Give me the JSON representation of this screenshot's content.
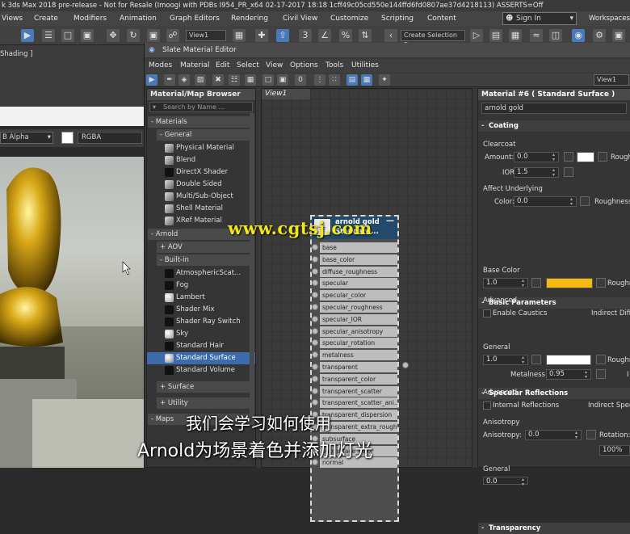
{
  "app": {
    "title": "k 3ds Max 2018 pre-release - Not for Resale (Imoogi with PDBs I954_PR_x64 02-17-2017 18:18 1cff49c05cd550e144ffd6fd0807ae37d4218113) ASSERTS=Off",
    "menu": [
      "Views",
      "Create",
      "Modifiers",
      "Animation",
      "Graph Editors",
      "Rendering",
      "Civil View",
      "Customize",
      "Scripting",
      "Content"
    ],
    "signin": "Sign In",
    "workspaces": "Workspaces:",
    "view_dropdown": "View",
    "selection_set": "Create Selection Se"
  },
  "viewport": {
    "shading_label": "Shading ]",
    "channel": "B Alpha",
    "rgba": "RGBA"
  },
  "slate": {
    "title": "Slate Material Editor",
    "menu": [
      "Modes",
      "Material",
      "Edit",
      "Select",
      "View",
      "Options",
      "Tools",
      "Utilities"
    ],
    "view_dropdown": "View1",
    "browser": {
      "title": "Material/Map Browser",
      "search_placeholder": "Search by Name ...",
      "materials_group": "- Materials",
      "general_group": "- General",
      "general_items": [
        "Physical Material",
        "Blend",
        "DirectX Shader",
        "Double Sided",
        "Multi/Sub-Object",
        "Shell Material",
        "XRef Material"
      ],
      "arnold_group": "- Arnold",
      "aov_group": "+ AOV",
      "builtin_group": "- Built-in",
      "builtin_items": [
        "AtmosphericScat...",
        "Fog",
        "Lambert",
        "Shader Mix",
        "Shader Ray Switch",
        "Sky",
        "Standard Hair",
        "Standard Surface",
        "Standard Volume"
      ],
      "surface_group": "+ Surface",
      "utility_group": "+ Utility",
      "maps_group": "- Maps"
    },
    "view_tab": "View1",
    "node": {
      "name": "arnold gold",
      "type": "Standard...",
      "ports": [
        "base",
        "base_color",
        "diffuse_roughness",
        "specular",
        "specular_color",
        "specular_roughness",
        "specular_IOR",
        "specular_anisotropy",
        "specular_rotation",
        "metalness",
        "transparent",
        "transparent_color",
        "transparent_scatter",
        "transparent_scatter_ani...",
        "transparent_dispersion",
        "transparent_extra_rough...",
        "subsurface",
        "subsurface_color",
        "normal"
      ]
    },
    "params": {
      "title": "Material #6  ( Standard Surface )",
      "material_name": "arnold gold",
      "coating": {
        "header": "Coating",
        "clearcoat": "Clearcoat",
        "amount_label": "Amount:",
        "amount": "0.0",
        "ior_label": "IOR:",
        "ior": "1.5",
        "roughness_label": "Roughn",
        "affect_underlying": "Affect Underlying",
        "color_label": "Color:",
        "color_val": "0.0",
        "roughness2_label": "Roughness:"
      },
      "basic": {
        "header": "Basic Parameters",
        "base_color": "Base Color",
        "base_val": "1.0",
        "roughness_label": "Roughn",
        "advanced": "Advanced",
        "enable_caustics": "Enable Caustics",
        "indirect_diffuse": "Indirect Diffu"
      },
      "specular": {
        "header": "Specular Reflections",
        "general": "General",
        "spec_val": "1.0",
        "roughness_label": "Roughn",
        "metalness_label": "Metalness:",
        "metalness": "0.95",
        "i_label": "I",
        "advanced": "Advanced",
        "internal_reflections": "Internal Reflections",
        "indirect_specular": "Indirect Specu",
        "anisotropy": "Anisotropy",
        "anisotropy_label": "Anisotropy:",
        "anisotropy_val": "0.0",
        "rotation_label": "Rotation:"
      },
      "transparency": {
        "header": "Transparency",
        "general": "General",
        "val": "0.0"
      }
    },
    "zoom": "100%"
  },
  "overlay": {
    "watermark": "www.cgtsj.com",
    "subtitle_line1": "我们会学习如何使用",
    "subtitle_line2": "Arnold为场景着色并添加灯光"
  },
  "colors": {
    "accent": "#3b6aad",
    "base_color_swatch": "#f5b912",
    "white_swatch": "#ffffff",
    "node_header": "#234a6b"
  }
}
